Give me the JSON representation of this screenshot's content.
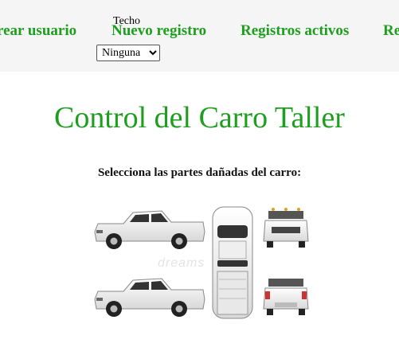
{
  "nav": {
    "items": [
      {
        "label": "rear usuario"
      },
      {
        "label": "Nuevo registro"
      },
      {
        "label": "Registros activos"
      },
      {
        "label": "Re"
      }
    ],
    "field_label": "Techo",
    "select": {
      "selected": "Ninguna",
      "options": [
        "Ninguna"
      ]
    }
  },
  "page": {
    "title": "Control del Carro Taller",
    "subtitle": "Selecciona las partes dañadas del carro:"
  },
  "image": {
    "watermark": "dreams",
    "views": [
      "side-left",
      "top",
      "front",
      "side-right",
      "back"
    ],
    "vehicle_color": "#f2f2f2"
  },
  "colors": {
    "accent": "#1e9e1e",
    "nav_bg": "#f5f5f5"
  }
}
